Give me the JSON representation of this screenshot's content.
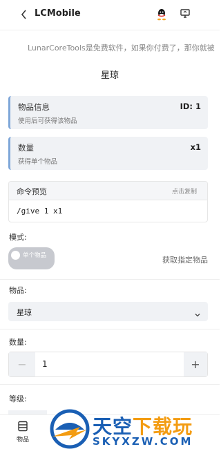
{
  "header": {
    "back_icon": "chevron-left-icon",
    "title": "LCMobile",
    "icons": [
      "qq-icon",
      "monitor-icon"
    ]
  },
  "notice": "LunarCoreTools是免费软件，如果你付费了，那你就被",
  "item_title": "星琼",
  "info_card": {
    "title": "物品信息",
    "subtitle": "使用后可获得该物品",
    "id_label": "ID: 1"
  },
  "qty_card": {
    "title": "数量",
    "subtitle": "获得单个物品",
    "value": "x1"
  },
  "preview": {
    "title": "命令预览",
    "copy_label": "点击复制",
    "command": "/give 1 x1"
  },
  "mode": {
    "label": "模式:",
    "toggle_label": "单个物品",
    "toggle_on": false,
    "description": "获取指定物品"
  },
  "item_select": {
    "label": "物品:",
    "value": "星琼"
  },
  "quantity": {
    "label": "数量:",
    "value": "1",
    "minus": "−",
    "plus": "+"
  },
  "level": {
    "label": "等级:"
  },
  "tabbar": {
    "items_label": "物品"
  },
  "watermark": {
    "brand_part1": "天空",
    "brand_part2": "下载玩",
    "domain": "SKYXZW.COM"
  },
  "colors": {
    "accent": "#7fa7d9",
    "card_bg": "#f0f2f5",
    "watermark_blue": "#1a5fb4",
    "watermark_orange": "#f39c12"
  }
}
